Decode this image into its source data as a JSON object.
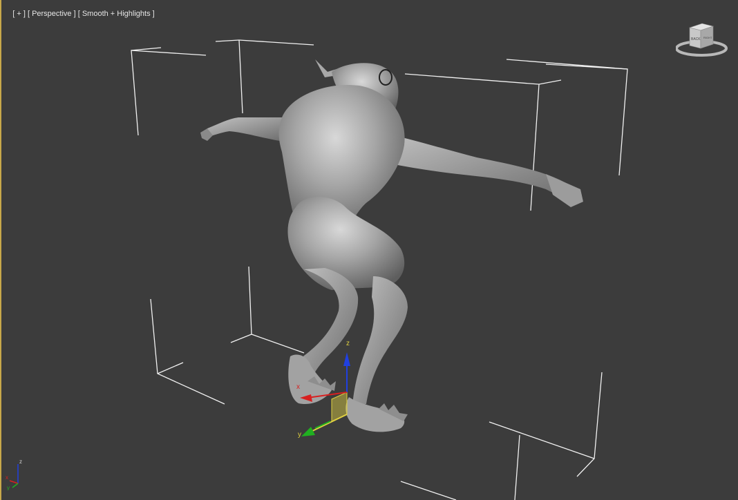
{
  "viewport": {
    "label_plus": "[ + ]",
    "label_view": "[ Perspective ]",
    "label_shading": "[ Smooth + Highlights ]",
    "background_color": "#3c3c3c",
    "active_border_color": "#c8a84a"
  },
  "viewcube": {
    "face_label": "BACK",
    "side_label": "RIGHT",
    "icon": "viewcube-icon"
  },
  "gizmo": {
    "x_label": "x",
    "y_label": "y",
    "z_label": "z",
    "x_color": "#d82020",
    "y_color": "#20b020",
    "z_color": "#2040e0",
    "plane_color": "#e0d040"
  },
  "corner_axis": {
    "x_label": "x",
    "y_label": "y",
    "z_label": "z"
  },
  "model": {
    "name": "creature-mesh",
    "color": "#9a9a9a"
  }
}
